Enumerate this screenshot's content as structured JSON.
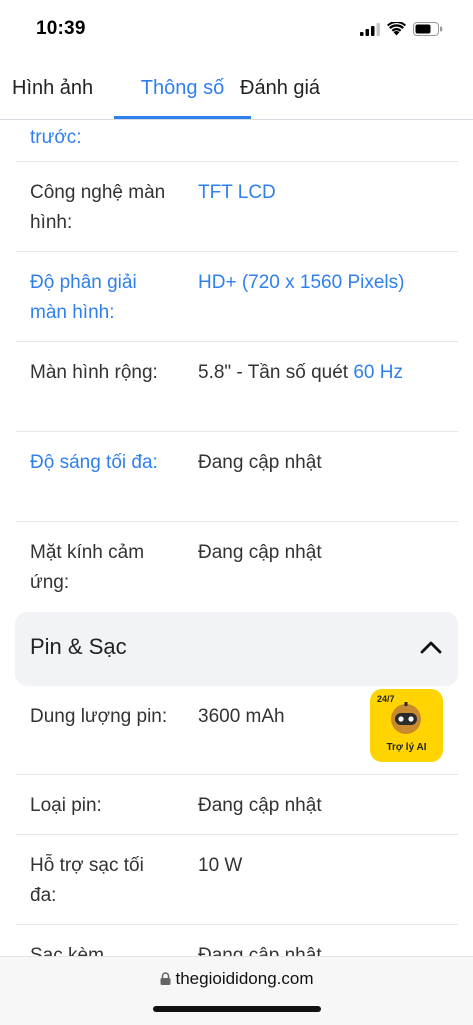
{
  "status": {
    "time": "10:39"
  },
  "tabs": [
    {
      "label": "Hình ảnh",
      "active": false
    },
    {
      "label": "Thông số",
      "active": true
    },
    {
      "label": "Đánh giá",
      "active": false
    }
  ],
  "specs_top": {
    "cut_label": "trước:",
    "rows": [
      {
        "label": "Công nghệ màn hình:",
        "value": "TFT LCD",
        "label_link": false,
        "value_link": true
      },
      {
        "label": "Độ phân giải màn hình:",
        "value": "HD+ (720 x 1560 Pixels)",
        "label_link": true,
        "value_link": true
      },
      {
        "label": "Màn hình rộng:",
        "value_prefix": "5.8\" - Tần số quét ",
        "value_link_part": "60 Hz",
        "label_link": false
      },
      {
        "label": "Độ sáng tối đa:",
        "value": "Đang cập nhật",
        "label_link": true,
        "value_link": false
      },
      {
        "label": "Mặt kính cảm ứng:",
        "value": "Đang cập nhật",
        "label_link": false,
        "value_link": false
      }
    ]
  },
  "battery_section": {
    "title": "Pin & Sạc",
    "rows": [
      {
        "label": "Dung lượng pin:",
        "value": "3600 mAh"
      },
      {
        "label": "Loại pin:",
        "value": "Đang cập nhật"
      },
      {
        "label": "Hỗ trợ sạc tối đa:",
        "value": "10 W"
      },
      {
        "label": "Sạc kèm",
        "value": "Đang cập nhật"
      }
    ]
  },
  "ai_assistant": {
    "badge": "24/7",
    "label": "Trợ lý AI"
  },
  "browser": {
    "url": "thegioididong.com"
  },
  "colors": {
    "accent": "#2f80ed",
    "ai_button": "#ffd400"
  }
}
